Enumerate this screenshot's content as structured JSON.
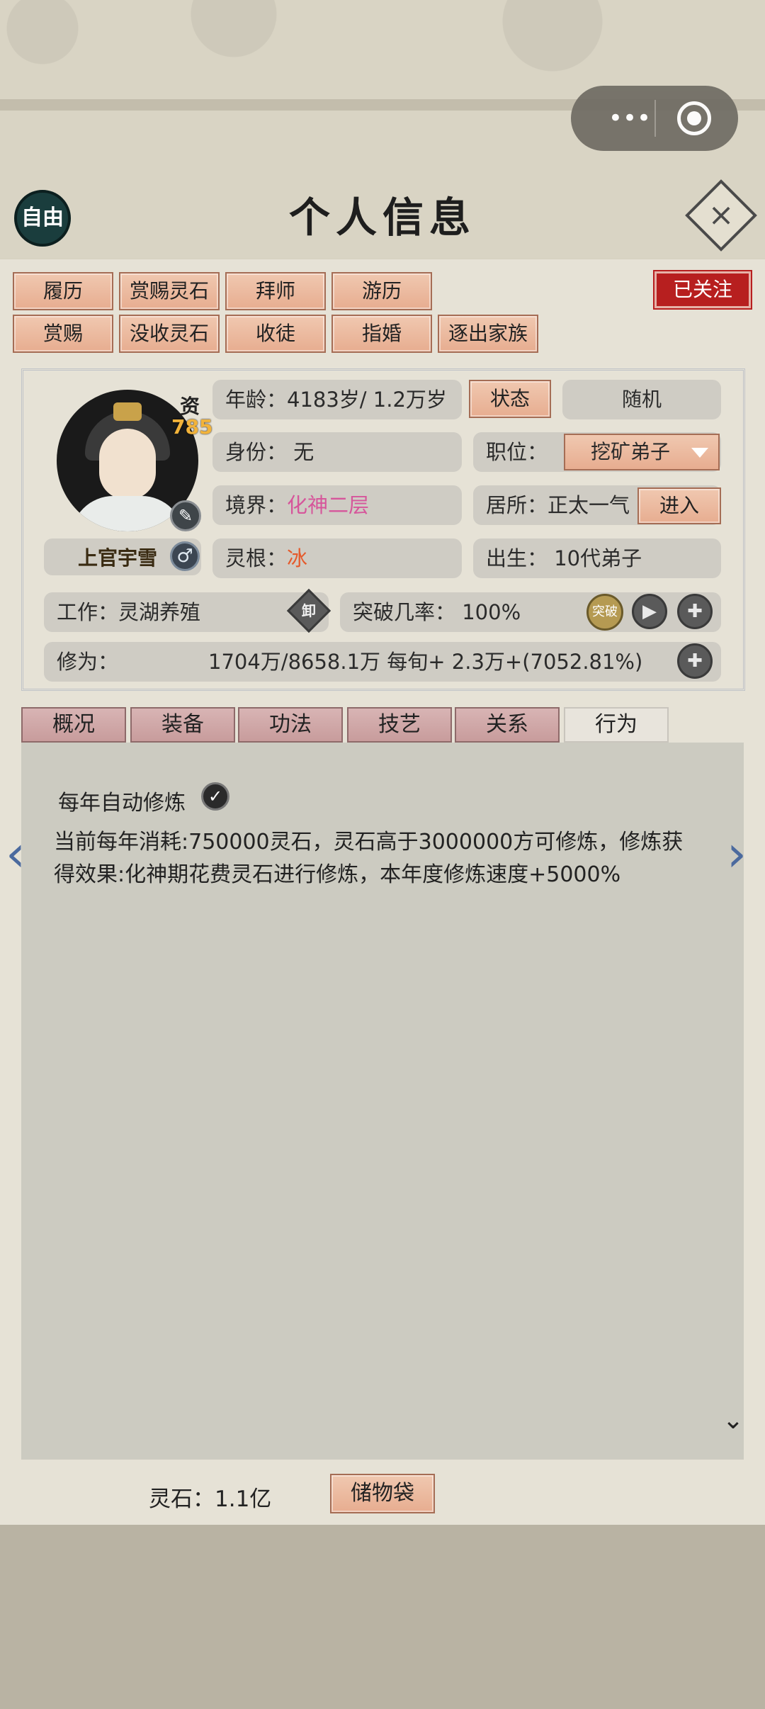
{
  "header": {
    "title": "个人信息",
    "free_label": "自由",
    "close_icon": "close-icon",
    "capsule_dots": "•••"
  },
  "actions": {
    "row1": [
      "履历",
      "赏赐灵石",
      "拜师",
      "游历"
    ],
    "row2": [
      "赏赐",
      "没收灵石",
      "收徒",
      "指婚",
      "逐出家族"
    ],
    "follow_label": "已关注"
  },
  "profile": {
    "aptitude_label": "资",
    "aptitude_value": "785",
    "name": "上官宇雪",
    "gender_icon": "♂",
    "age": "年龄：4183岁/ 1.2万岁",
    "status_button": "状态",
    "random_button": "随机",
    "identity": "身份：  无",
    "position_label": "职位：",
    "position_value": "挖矿弟子",
    "realm_label": "境界：",
    "realm_value": "化神二层",
    "residence": "居所：正太一气",
    "residence_tail": ")",
    "enter_button": "进入",
    "root_label": "灵根：",
    "root_value": "冰",
    "birth": "出生：  10代弟子",
    "work": "工作：灵湖养殖",
    "unload_label": "卸",
    "breakthrough": "突破几率：  100%",
    "breakthrough_icon_label": "突破",
    "cultivation_label": "修为：",
    "cultivation_value": "1704万/8658.1万   每旬+   2.3万+(7052.81%)"
  },
  "tabs": [
    {
      "label": "概况",
      "active": false
    },
    {
      "label": "装备",
      "active": false
    },
    {
      "label": "功法",
      "active": false
    },
    {
      "label": "技艺",
      "active": false
    },
    {
      "label": "关系",
      "active": false
    },
    {
      "label": "行为",
      "active": true
    }
  ],
  "behavior": {
    "auto_cultivate_label": "每年自动修炼",
    "description": "当前每年消耗:750000灵石，灵石高于3000000方可修炼，修炼获得效果:化神期花费灵石进行修炼，本年度修炼速度+5000%"
  },
  "footer": {
    "spirit_stone": "灵石：1.1亿",
    "bag_label": "储物袋"
  }
}
